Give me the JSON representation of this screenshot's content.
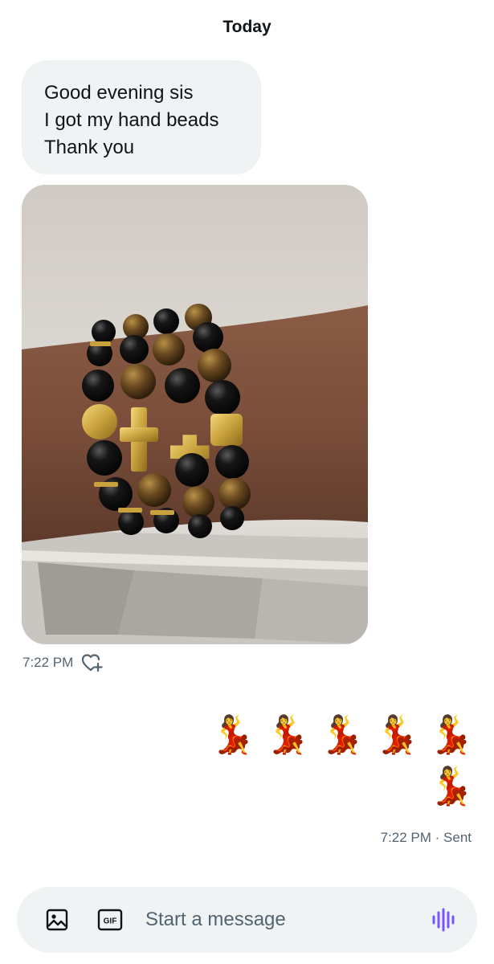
{
  "conversation": {
    "date_label": "Today"
  },
  "incoming_message": {
    "lines": [
      "Good evening sis",
      "I got my hand beads",
      "Thank you"
    ],
    "photo_alt": "",
    "timestamp": "7:22 PM"
  },
  "outgoing_message": {
    "emoji": [
      "💃",
      "💃",
      "💃",
      "💃",
      "💃",
      "💃"
    ],
    "status": "7:22 PM · Sent"
  },
  "composer": {
    "placeholder": "Start a message",
    "gif_label": "GIF",
    "accent_color": "#7856ff"
  },
  "icons": {
    "image": "image-icon",
    "gif": "gif-icon",
    "voice": "voice-wave-icon",
    "react": "heart-plus-icon"
  }
}
